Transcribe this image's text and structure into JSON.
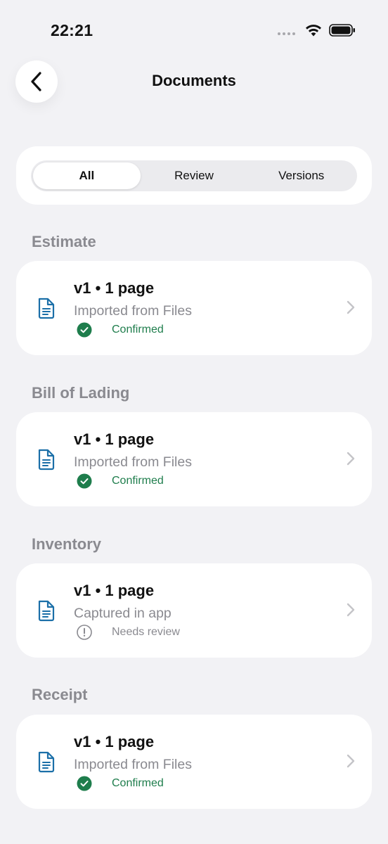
{
  "status_bar": {
    "time": "22:21"
  },
  "header": {
    "title": "Documents"
  },
  "segments": [
    {
      "label": "All",
      "active": true
    },
    {
      "label": "Review",
      "active": false
    },
    {
      "label": "Versions",
      "active": false
    }
  ],
  "sections": [
    {
      "label": "Estimate",
      "card": {
        "title": "v1 • 1 page",
        "subtitle": "Imported from Files",
        "status": "Confirmed",
        "status_type": "confirmed"
      }
    },
    {
      "label": "Bill of Lading",
      "card": {
        "title": "v1 • 1 page",
        "subtitle": "Imported from Files",
        "status": "Confirmed",
        "status_type": "confirmed"
      }
    },
    {
      "label": "Inventory",
      "card": {
        "title": "v1 • 1 page",
        "subtitle": "Captured in app",
        "status": "Needs review",
        "status_type": "review"
      }
    },
    {
      "label": "Receipt",
      "card": {
        "title": "v1 • 1 page",
        "subtitle": "Imported from Files",
        "status": "Confirmed",
        "status_type": "confirmed"
      }
    }
  ],
  "colors": {
    "background": "#f2f2f5",
    "card": "#ffffff",
    "doc_icon": "#1b6fa8",
    "confirmed": "#1e7d4c",
    "muted": "#8a8a90"
  }
}
